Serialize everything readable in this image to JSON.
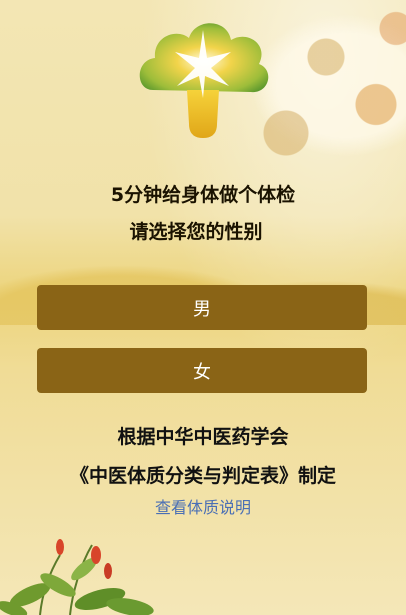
{
  "header": {
    "title": "5分钟给身体做个体检",
    "subtitle": "请选择您的性别"
  },
  "gender_options": {
    "male_label": "男",
    "female_label": "女"
  },
  "reference": {
    "line1": "根据中华中医药学会",
    "line2": "《中医体质分类与判定表》制定",
    "link_text": "查看体质说明"
  },
  "colors": {
    "button_bg": "#8a6416",
    "link": "#4a6fb5",
    "logo_green": "#6fa83a",
    "logo_yellow": "#e8c02a"
  },
  "icons": {
    "logo": "mushroom-sun-logo-icon",
    "decoration": "herb-plant-icon"
  }
}
